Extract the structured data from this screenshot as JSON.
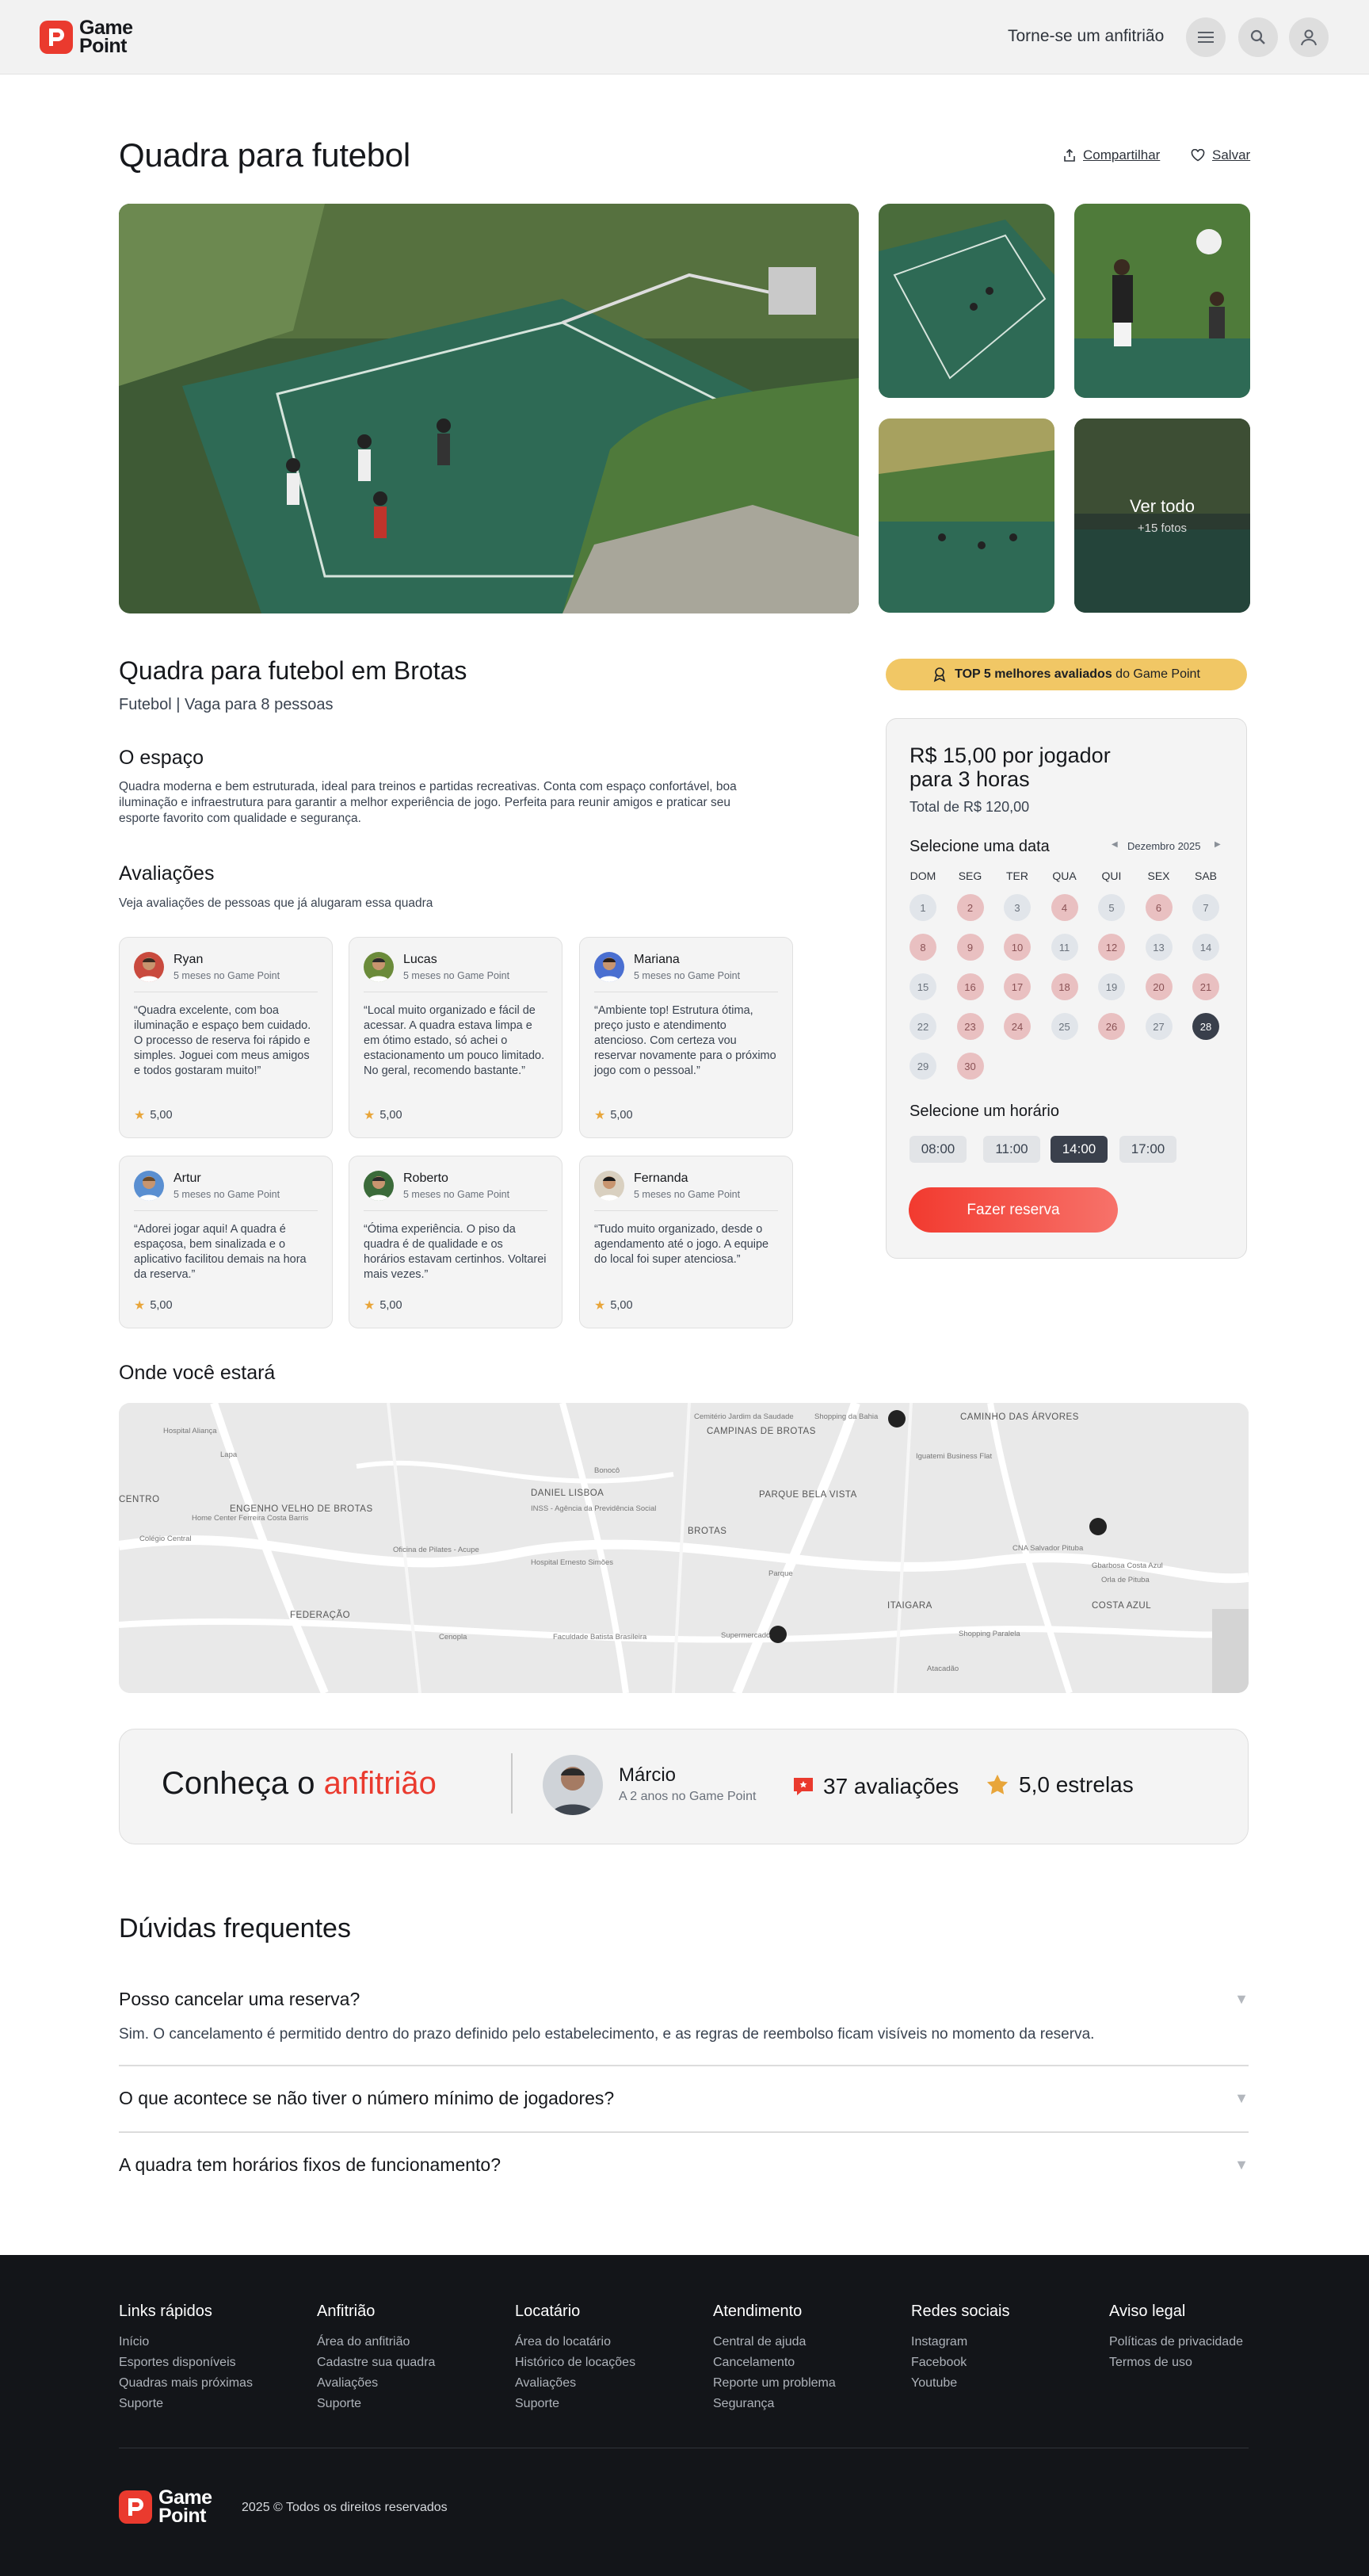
{
  "brand": {
    "line1": "Game",
    "line2": "Point"
  },
  "header": {
    "host_link": "Torne-se um anfitrião"
  },
  "title": "Quadra para futebol",
  "actions": {
    "share": "Compartilhar",
    "save": "Salvar"
  },
  "gallery": {
    "see_all": "Ver todo",
    "more_photos": "+15 fotos"
  },
  "listing": {
    "name": "Quadra para futebol em Brotas",
    "subtitle": "Futebol | Vaga para 8 pessoas"
  },
  "space": {
    "heading": "O espaço",
    "text": "Quadra moderna e bem estruturada, ideal para treinos e partidas recreativas. Conta com espaço confortável, boa iluminação e infraestrutura para garantir a melhor experiência de jogo. Perfeita para reunir amigos e praticar seu esporte favorito com qualidade e segurança."
  },
  "reviews": {
    "heading": "Avaliações",
    "subtitle": "Veja avaliações de pessoas que já alugaram essa quadra",
    "items": [
      {
        "name": "Ryan",
        "time": "5 meses no Game Point",
        "text": "“Quadra excelente, com boa iluminação e espaço bem cuidado. O processo de reserva foi rápido e simples. Joguei com meus amigos e todos gostaram muito!”",
        "rating": "5,00"
      },
      {
        "name": "Lucas",
        "time": "5 meses no Game Point",
        "text": "“Local muito organizado e fácil de acessar. A quadra estava limpa e em ótimo estado, só achei o estacionamento um pouco limitado. No geral, recomendo bastante.”",
        "rating": "5,00"
      },
      {
        "name": "Mariana",
        "time": "5 meses no Game Point",
        "text": "“Ambiente top! Estrutura ótima, preço justo e atendimento atencioso. Com certeza vou reservar novamente para o próximo jogo com o pessoal.”",
        "rating": "5,00"
      },
      {
        "name": "Artur",
        "time": "5 meses no Game Point",
        "text": "“Adorei jogar aqui! A quadra é espaçosa, bem sinalizada e o aplicativo facilitou demais na hora da reserva.”",
        "rating": "5,00"
      },
      {
        "name": "Roberto",
        "time": "5 meses no Game Point",
        "text": "“Ótima experiência. O piso da quadra é de qualidade e os horários estavam certinhos. Voltarei mais vezes.”",
        "rating": "5,00"
      },
      {
        "name": "Fernanda",
        "time": "5 meses no Game Point",
        "text": "“Tudo muito organizado, desde o agendamento até o jogo. A equipe do local foi super atenciosa.”",
        "rating": "5,00"
      }
    ]
  },
  "badge": {
    "bold": "TOP 5 melhores avaliados",
    "rest": " do Game Point"
  },
  "booking": {
    "price_line1": "R$ 15,00 por jogador",
    "price_line2": "para 3 horas",
    "total": "Total de R$ 120,00",
    "date_heading": "Selecione uma data",
    "month": "Dezembro 2025",
    "weekdays": [
      "DOM",
      "SEG",
      "TER",
      "QUA",
      "QUI",
      "SEX",
      "SAB"
    ],
    "days": [
      {
        "n": "1",
        "s": "n"
      },
      {
        "n": "2",
        "s": "u"
      },
      {
        "n": "3",
        "s": "n"
      },
      {
        "n": "4",
        "s": "u"
      },
      {
        "n": "5",
        "s": "n"
      },
      {
        "n": "6",
        "s": "u"
      },
      {
        "n": "7",
        "s": "n"
      },
      {
        "n": "8",
        "s": "u"
      },
      {
        "n": "9",
        "s": "u"
      },
      {
        "n": "10",
        "s": "u"
      },
      {
        "n": "11",
        "s": "n"
      },
      {
        "n": "12",
        "s": "u"
      },
      {
        "n": "13",
        "s": "n"
      },
      {
        "n": "14",
        "s": "n"
      },
      {
        "n": "15",
        "s": "n"
      },
      {
        "n": "16",
        "s": "u"
      },
      {
        "n": "17",
        "s": "u"
      },
      {
        "n": "18",
        "s": "u"
      },
      {
        "n": "19",
        "s": "n"
      },
      {
        "n": "20",
        "s": "u"
      },
      {
        "n": "21",
        "s": "u"
      },
      {
        "n": "22",
        "s": "n"
      },
      {
        "n": "23",
        "s": "u"
      },
      {
        "n": "24",
        "s": "u"
      },
      {
        "n": "25",
        "s": "n"
      },
      {
        "n": "26",
        "s": "u"
      },
      {
        "n": "27",
        "s": "n"
      },
      {
        "n": "28",
        "s": "s"
      },
      {
        "n": "29",
        "s": "n"
      },
      {
        "n": "30",
        "s": "u"
      }
    ],
    "time_heading": "Selecione um horário",
    "times": [
      "08:00",
      "11:00",
      "14:00",
      "17:00"
    ],
    "selected_time": "14:00",
    "cta": "Fazer reserva"
  },
  "map": {
    "heading": "Onde você estará",
    "labels": [
      "CAMINHO DAS ÁRVORES",
      "CAMPINAS DE BROTAS",
      "PARQUE BELA VISTA",
      "ENGENHO VELHO DE BROTAS",
      "BROTAS",
      "DANIEL LISBOA",
      "FEDERAÇÃO",
      "ITAIGARA",
      "COSTA AZUL",
      "CENTRO",
      "Lapa",
      "Cemitério Jardim da Saudade",
      "Shopping da Bahia",
      "Iguatemi Business Flat",
      "Gbarbosa Costa Azul",
      "CNA Salvador Pituba",
      "Shopping Paralela",
      "Orla de Pituba",
      "Home Center Ferreira Costa Barris",
      "Hospital Aliança",
      "INSS - Agência da Previdência Social",
      "Hospital Ernesto Simões",
      "Oficina de Pilates - Acupe",
      "Colégio Central",
      "Faculdade Batista Brasileira",
      "Supermercado",
      "Cenopla",
      "Parque",
      "Atacadão",
      "Bonocô"
    ]
  },
  "host": {
    "title_a": "Conheça o ",
    "title_b": "anfitrião",
    "name": "Márcio",
    "since": "A 2 anos no Game Point",
    "reviews": "37 avaliações",
    "stars": "5,0 estrelas"
  },
  "faq": {
    "heading": "Dúvidas frequentes",
    "items": [
      {
        "q": "Posso cancelar uma reserva?",
        "a": "Sim. O cancelamento é permitido dentro do prazo definido pelo estabelecimento, e as regras de reembolso ficam visíveis no momento da reserva."
      },
      {
        "q": "O que acontece se não tiver o número mínimo de jogadores?",
        "a": ""
      },
      {
        "q": "A quadra tem horários fixos de funcionamento?",
        "a": ""
      }
    ]
  },
  "footer": {
    "columns": [
      {
        "title": "Links rápidos",
        "links": [
          "Início",
          "Esportes disponíveis",
          "Quadras mais próximas",
          "Suporte"
        ]
      },
      {
        "title": "Anfitrião",
        "links": [
          "Área do anfitrião",
          "Cadastre sua quadra",
          "Avaliações",
          "Suporte"
        ]
      },
      {
        "title": "Locatário",
        "links": [
          "Área do locatário",
          "Histórico de locações",
          "Avaliações",
          "Suporte"
        ]
      },
      {
        "title": "Atendimento",
        "links": [
          "Central de ajuda",
          "Cancelamento",
          "Reporte um problema",
          "Segurança"
        ]
      },
      {
        "title": "Redes sociais",
        "links": [
          "Instagram",
          "Facebook",
          "Youtube"
        ]
      },
      {
        "title": "Aviso legal",
        "links": [
          "Políticas de privacidade",
          "Termos de uso"
        ]
      }
    ],
    "copyright": "2025 © Todos os direitos reservados"
  },
  "colors": {
    "brand": "#ea3a2e",
    "star": "#e8a53a",
    "badge": "#f1c765",
    "footer_bg": "#131519",
    "selected": "#3a404c"
  }
}
